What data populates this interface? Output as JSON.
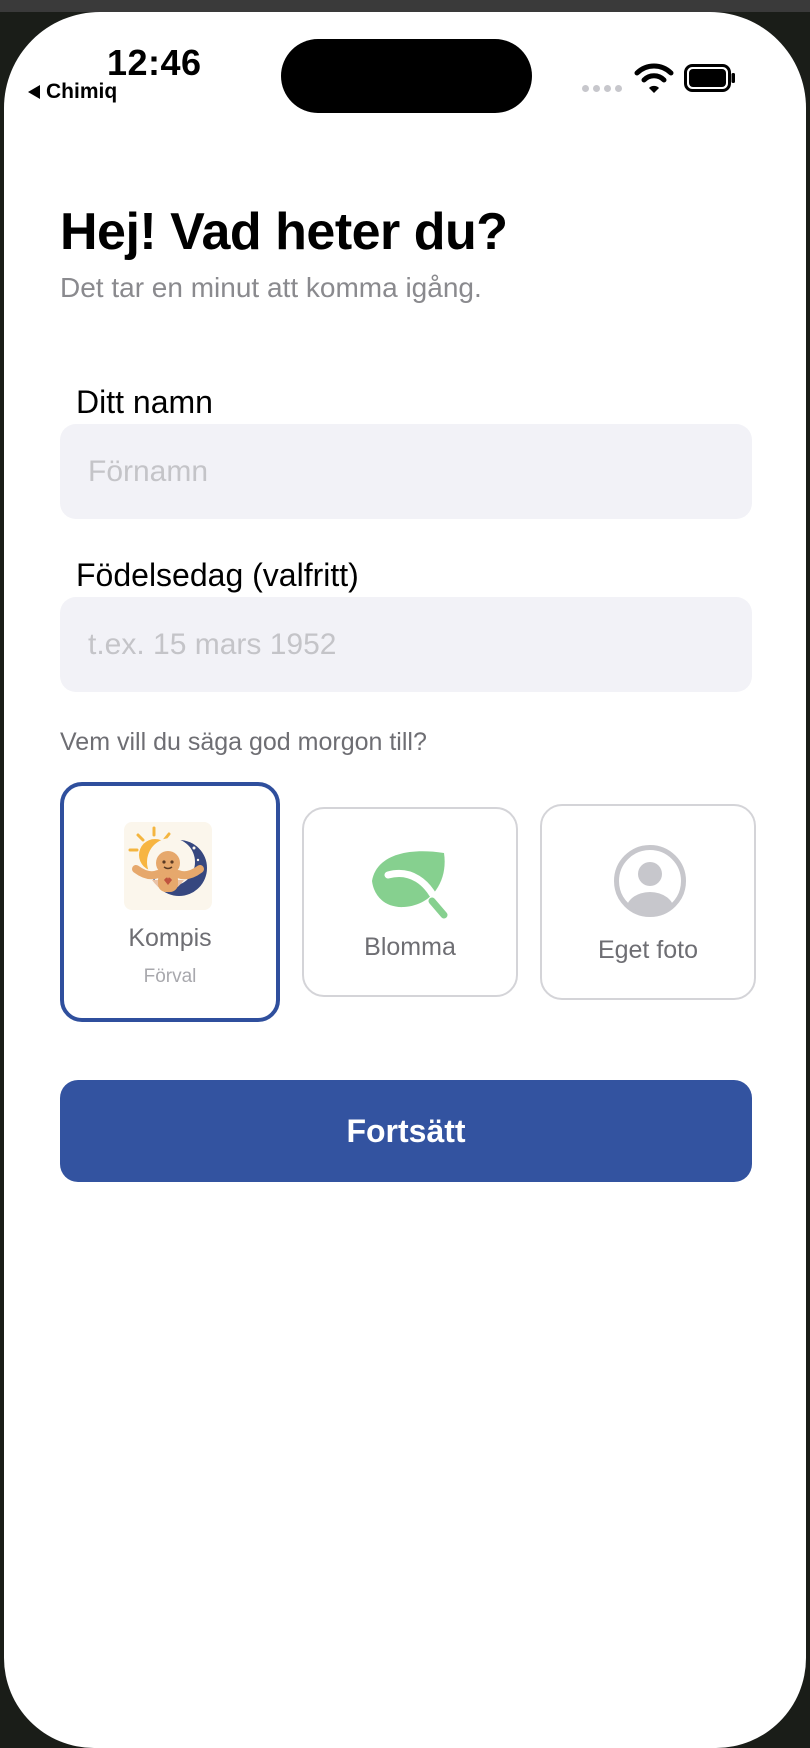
{
  "status_bar": {
    "time": "12:46",
    "back_label": "Chimiq"
  },
  "header": {
    "title": "Hej! Vad heter du?",
    "subtitle": "Det tar en minut att komma igång."
  },
  "form": {
    "name_label": "Ditt namn",
    "name_placeholder": "Förnamn",
    "name_value": "",
    "birthday_label": "Födelsedag (valfritt)",
    "birthday_placeholder": "t.ex. 15 mars 1952",
    "birthday_value": ""
  },
  "avatar_picker": {
    "question": "Vem vill du säga god morgon till?",
    "options": [
      {
        "label": "Kompis",
        "sublabel": "Förval",
        "icon": "kompis-mascot-icon",
        "selected": true
      },
      {
        "label": "Blomma",
        "icon": "leaf-icon",
        "selected": false
      },
      {
        "label": "Eget foto",
        "icon": "user-photo-icon",
        "selected": false
      }
    ]
  },
  "actions": {
    "continue_label": "Fortsätt"
  },
  "colors": {
    "accent": "#3353a0",
    "selected_border": "#2f4f9d",
    "leaf_green": "#86d08f",
    "field_bg": "#f2f2f7",
    "muted_text": "#8a8a8e"
  }
}
